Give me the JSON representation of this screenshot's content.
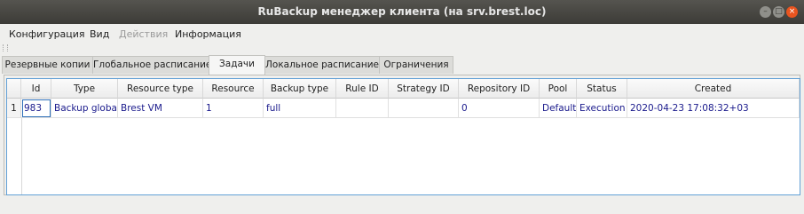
{
  "window": {
    "title": "RuBackup менеджер клиента (на srv.brest.loc)",
    "controls": {
      "minimize": "–",
      "maximize": "□",
      "close": "×"
    }
  },
  "menu": {
    "configuration": "Конфигурация",
    "view": "Вид",
    "actions": "Действия",
    "info": "Информация"
  },
  "tabs": {
    "backup_copies": "Резервные копии",
    "global_schedule": "Глобальное расписание",
    "tasks": "Задачи",
    "local_schedule": "Локальное расписание",
    "restrictions": "Ограничения"
  },
  "table": {
    "headers": {
      "id": "Id",
      "type": "Type",
      "resource_type": "Resource type",
      "resource": "Resource",
      "backup_type": "Backup type",
      "rule_id": "Rule ID",
      "strategy_id": "Strategy ID",
      "repository_id": "Repository ID",
      "pool": "Pool",
      "status": "Status",
      "created": "Created"
    },
    "rows": [
      {
        "num": "1",
        "id": "983",
        "type": "Backup global",
        "resource_type": "Brest VM",
        "resource": "1",
        "backup_type": "full",
        "rule_id": "",
        "strategy_id": "",
        "repository_id": "0",
        "pool": "Default",
        "status": "Execution",
        "created": "2020-04-23 17:08:32+03"
      }
    ]
  }
}
